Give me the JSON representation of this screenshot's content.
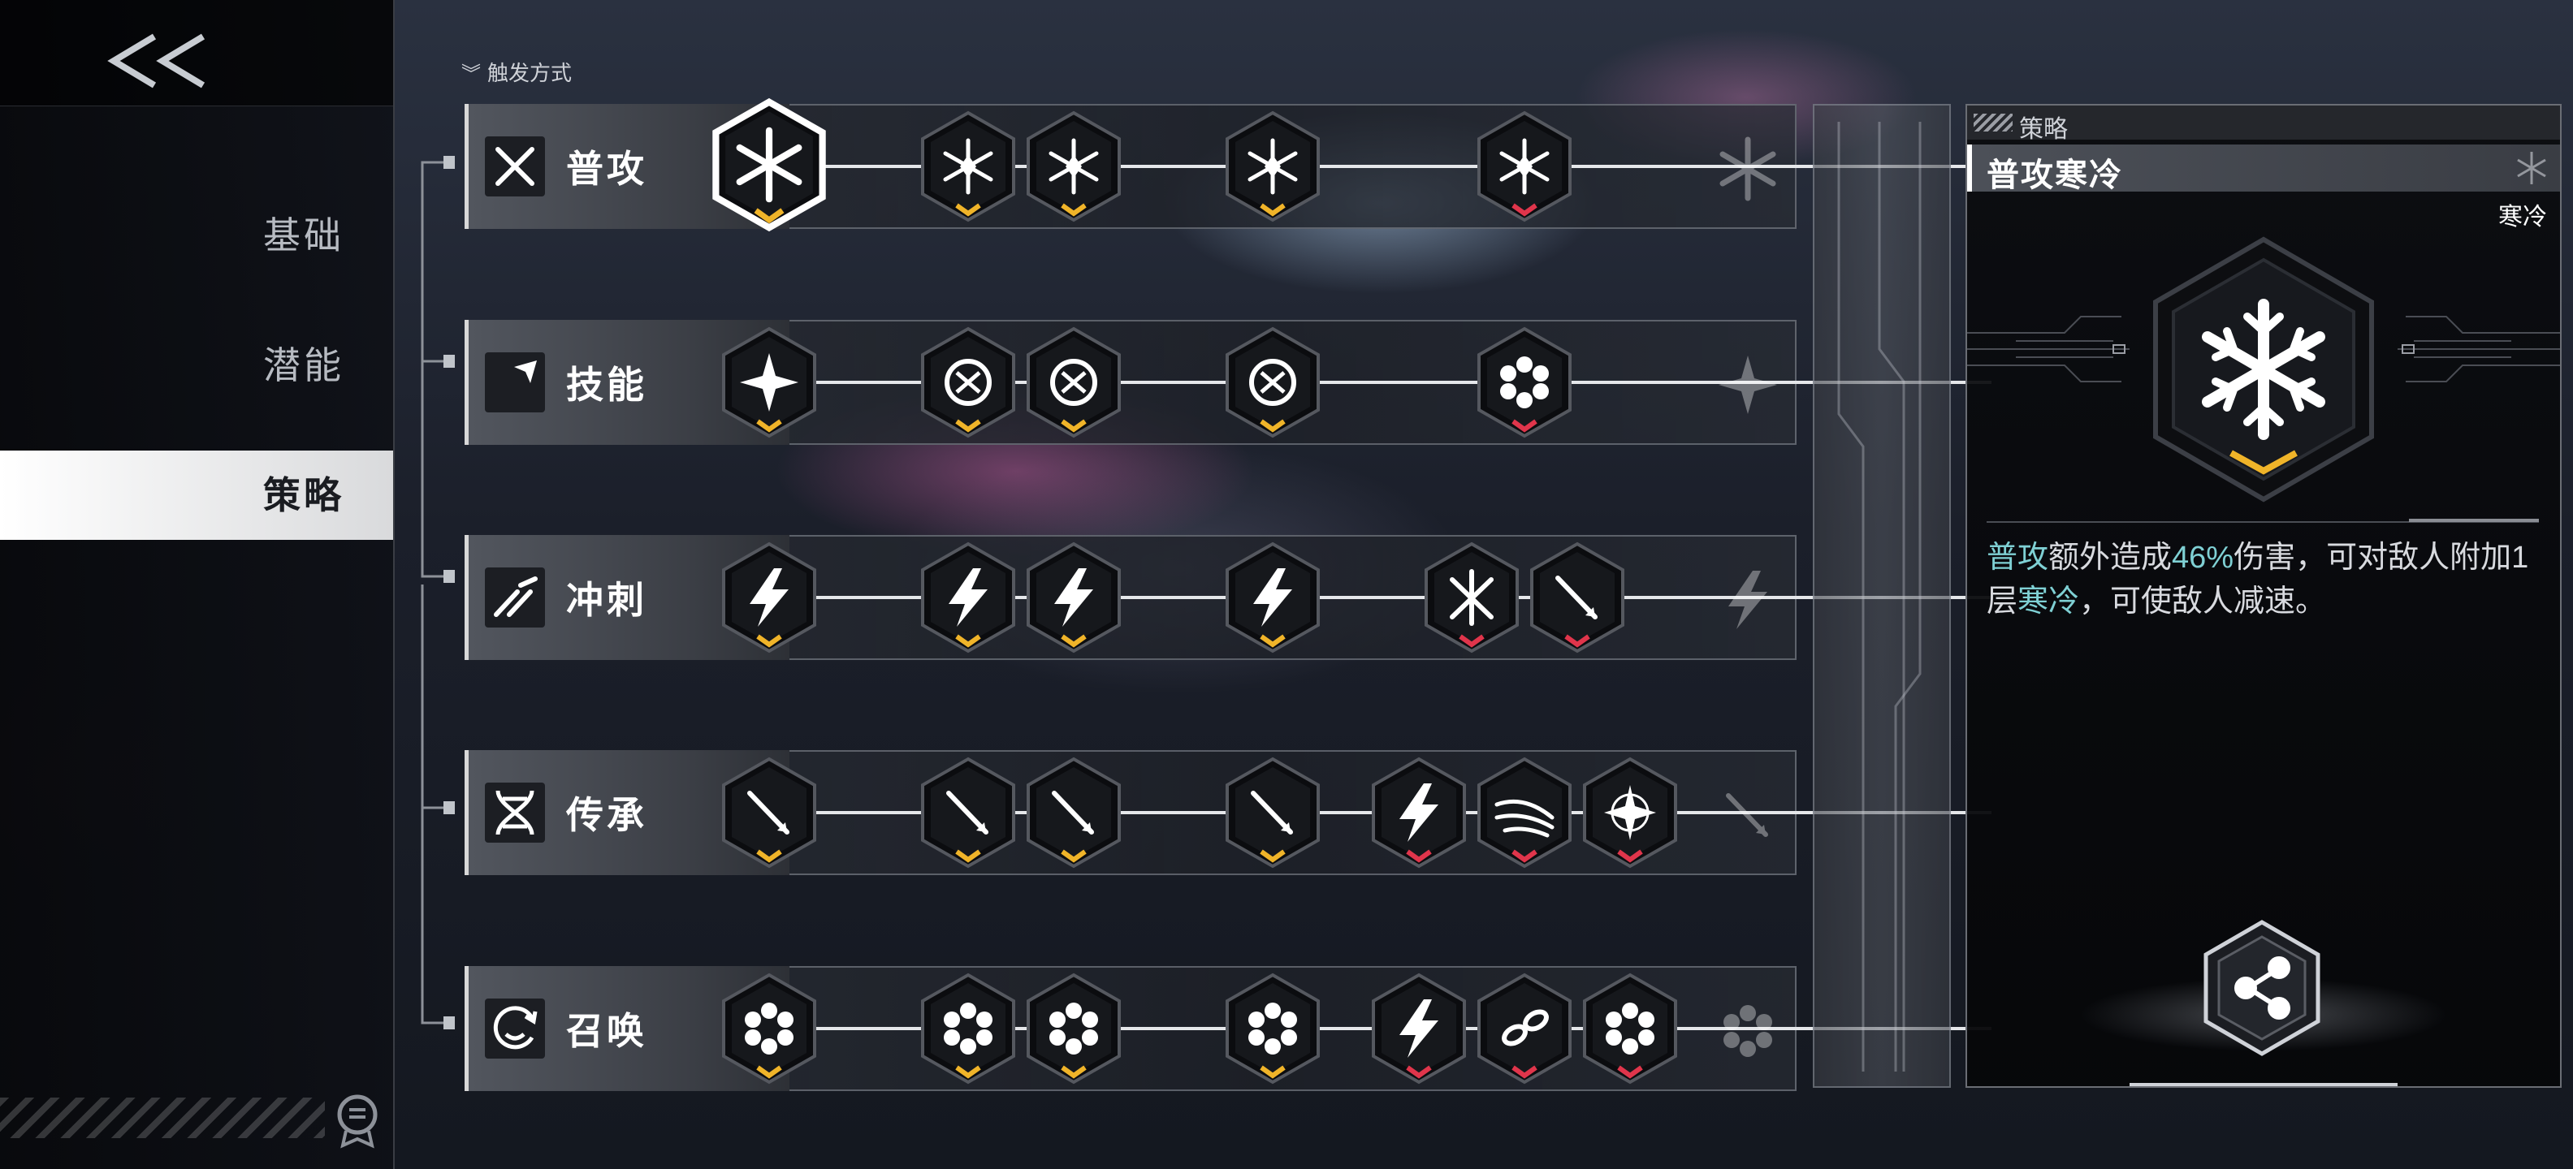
{
  "nav": {
    "back_icon": "double-chevron-left-icon",
    "items": [
      {
        "label": "基础",
        "active": false
      },
      {
        "label": "潜能",
        "active": false
      },
      {
        "label": "策略",
        "active": true
      }
    ],
    "help_icon": "scroll-badge-icon"
  },
  "trigger": {
    "label": "触发方式",
    "icon": "double-chevron-down-icon"
  },
  "rows": [
    {
      "label": "普攻",
      "icon": "crossed-swords-icon",
      "node_icons": [
        "snowflake-icon",
        "ice-crystal-icon",
        "ice-crystal-icon",
        "ice-crystal-icon",
        "ice-crystal-icon"
      ],
      "ghost_icon": "snowflake-icon"
    },
    {
      "label": "技能",
      "icon": "arrow-strike-icon",
      "node_icons": [
        "shuriken-icon",
        "vortex-icon",
        "vortex-icon",
        "vortex-icon",
        "flower-icon"
      ],
      "ghost_icon": "shuriken-icon"
    },
    {
      "label": "冲刺",
      "icon": "dash-icon",
      "node_icons": [
        "lightning-icon",
        "lightning-icon",
        "lightning-icon",
        "lightning-icon",
        "burst-icon",
        "spear-icon"
      ],
      "ghost_icon": "lightning-icon"
    },
    {
      "label": "传承",
      "icon": "dna-icon",
      "node_icons": [
        "spear-icon",
        "spear-icon",
        "spear-icon",
        "spear-icon",
        "lightning-icon",
        "wings-icon",
        "star-icon"
      ],
      "ghost_icon": "spear-icon"
    },
    {
      "label": "召唤",
      "icon": "summon-circle-icon",
      "node_icons": [
        "flower-icon",
        "flower-icon",
        "flower-icon",
        "flower-icon",
        "lightning-icon",
        "chain-icon",
        "flower-icon"
      ],
      "ghost_icon": "flower-icon"
    }
  ],
  "detail": {
    "header_label": "策略",
    "title": "普攻寒冷",
    "tag": "寒冷",
    "big_icon": "snowflake-icon",
    "desc": {
      "kw1": "普攻",
      "t1": "额外造成",
      "kw2": "46%",
      "t2": "伤害，可对敌人附加1层",
      "kw3": "寒冷",
      "t3": "，可使敌人减速。"
    },
    "share_icon": "share-icon"
  },
  "colors": {
    "accent_teal": "#7fd0d4",
    "gold_chevron": "#f0b429",
    "red_chevron": "#e0354b"
  }
}
